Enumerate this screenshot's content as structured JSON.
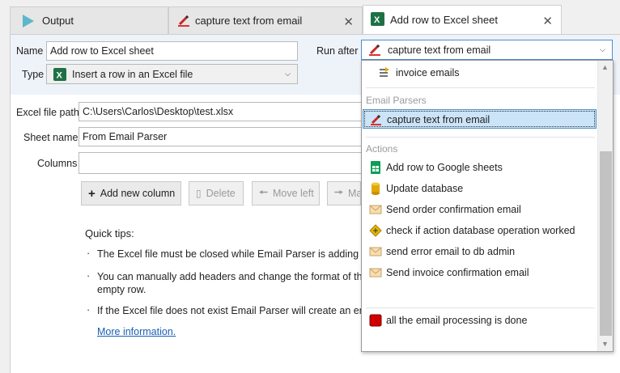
{
  "tabs": [
    {
      "label": "Output"
    },
    {
      "label": "capture text from email"
    },
    {
      "label": "Add row to Excel sheet"
    }
  ],
  "form": {
    "name_label": "Name",
    "name_value": "Add row to Excel sheet",
    "type_label": "Type",
    "type_value": "Insert a row in an Excel file",
    "run_after_label": "Run after",
    "run_after_value": "capture text from email",
    "excel_path_label": "Excel file path",
    "excel_path_value": "C:\\Users\\Carlos\\Desktop\\test.xlsx",
    "sheet_label": "Sheet name",
    "sheet_value": "From Email Parser",
    "columns_label": "Columns"
  },
  "buttons": {
    "add_column": "Add new column",
    "delete": "Delete",
    "move_left": "Move left",
    "move_right": "Ma"
  },
  "tips": {
    "title": "Quick tips:",
    "items": [
      "The Excel file must be closed while Email Parser is adding cells",
      "You can manually add headers and change the format of the E",
      "empty row.",
      "If the Excel file does not exist Email Parser will create an empty"
    ],
    "more_info": "More information."
  },
  "dropdown": {
    "top_item": "invoice emails",
    "group_parsers": "Email Parsers",
    "selected_item": "capture text from email",
    "group_actions": "Actions",
    "actions": [
      "Add row to Google sheets",
      "Update database",
      "Send order confirmation email",
      "check if action database operation worked",
      "send error email to db admin",
      "Send invoice confirmation email"
    ],
    "last_item": "all the email processing is done"
  },
  "colors": {
    "accent_blue": "#4a90d0",
    "selection_bg": "#cce4f7",
    "link": "#1a5fb4",
    "excel_green": "#1e7145"
  }
}
